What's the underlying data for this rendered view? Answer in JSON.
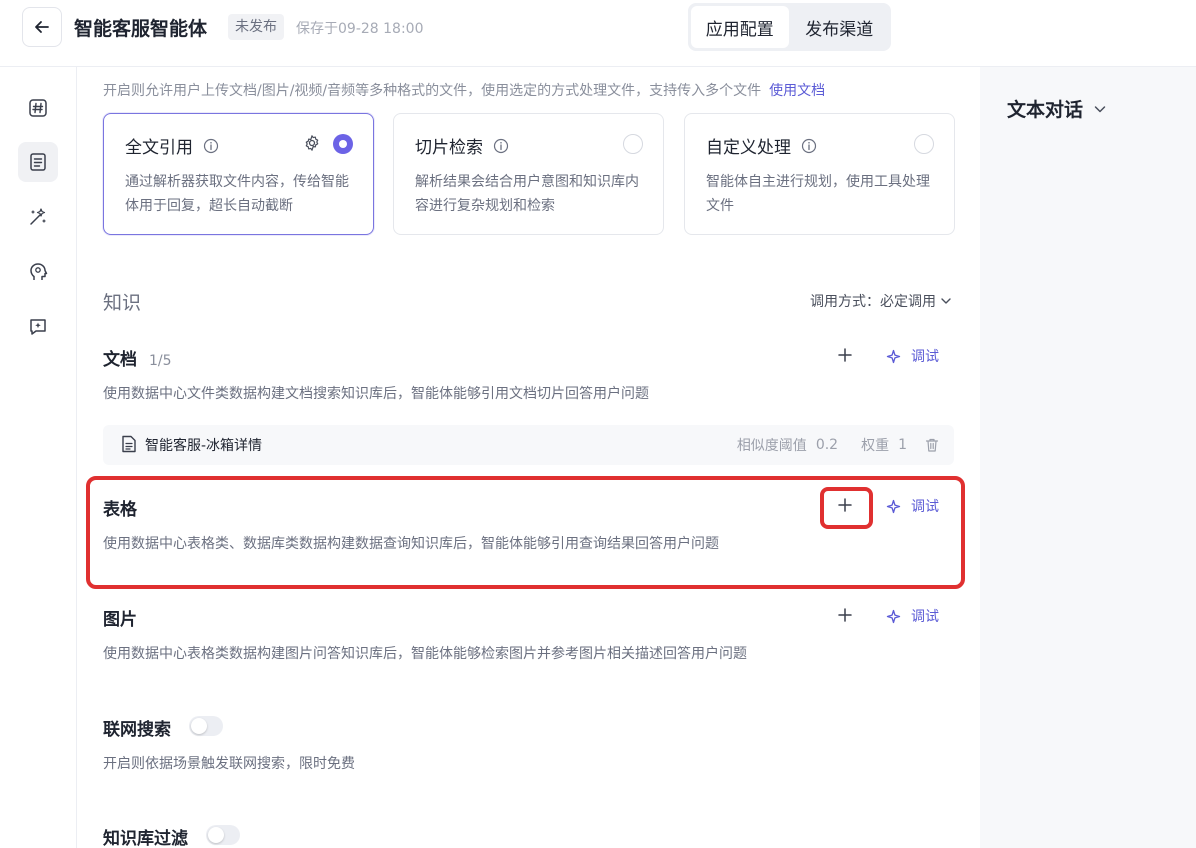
{
  "header": {
    "title": "智能客服智能体",
    "status": "未发布",
    "saved": "保存于09-28 18:00",
    "tabs": [
      {
        "label": "应用配置",
        "active": true
      },
      {
        "label": "发布渠道",
        "active": false
      }
    ]
  },
  "rail": {
    "items": [
      {
        "icon": "hash-icon",
        "active": false
      },
      {
        "icon": "document-list-icon",
        "active": true
      },
      {
        "icon": "magic-wand-icon",
        "active": false
      },
      {
        "icon": "head-idea-icon",
        "active": false
      },
      {
        "icon": "chat-sparkle-icon",
        "active": false
      }
    ]
  },
  "upload": {
    "description": "开启则允许用户上传文档/图片/视频/音频等多种格式的文件，使用选定的方式处理文件，支持传入多个文件",
    "doc_link": "使用文档"
  },
  "modes": [
    {
      "title": "全文引用",
      "desc": "通过解析器获取文件内容，传给智能体用于回复，超长自动截断",
      "selected": true
    },
    {
      "title": "切片检索",
      "desc": "解析结果会结合用户意图和知识库内容进行复杂规划和检索",
      "selected": false
    },
    {
      "title": "自定义处理",
      "desc": "智能体自主进行规划，使用工具处理文件",
      "selected": false
    }
  ],
  "knowledge": {
    "heading": "知识",
    "call_mode": "调用方式：必定调用",
    "debug_label": "调试",
    "documents": {
      "title": "文档",
      "count": "1/5",
      "desc": "使用数据中心文件类数据构建文档搜索知识库后，智能体能够引用文档切片回答用户问题",
      "items": [
        {
          "name": "智能客服-冰箱详情",
          "similarity_label": "相似度阈值",
          "similarity": "0.2",
          "weight_label": "权重",
          "weight": "1"
        }
      ]
    },
    "tables": {
      "title": "表格",
      "desc": "使用数据中心表格类、数据库类数据构建数据查询知识库后，智能体能够引用查询结果回答用户问题"
    },
    "images": {
      "title": "图片",
      "desc": "使用数据中心表格类数据构建图片问答知识库后，智能体能够检索图片并参考图片相关描述回答用户问题"
    }
  },
  "web_search": {
    "title": "联网搜索",
    "desc": "开启则依据场景触发联网搜索，限时免费",
    "enabled": false
  },
  "kb_filter": {
    "title": "知识库过滤",
    "enabled": false
  },
  "right_panel": {
    "title": "文本对话"
  },
  "colors": {
    "accent": "#6c63e6",
    "link": "#5b5bd6",
    "highlight": "#e03030"
  }
}
